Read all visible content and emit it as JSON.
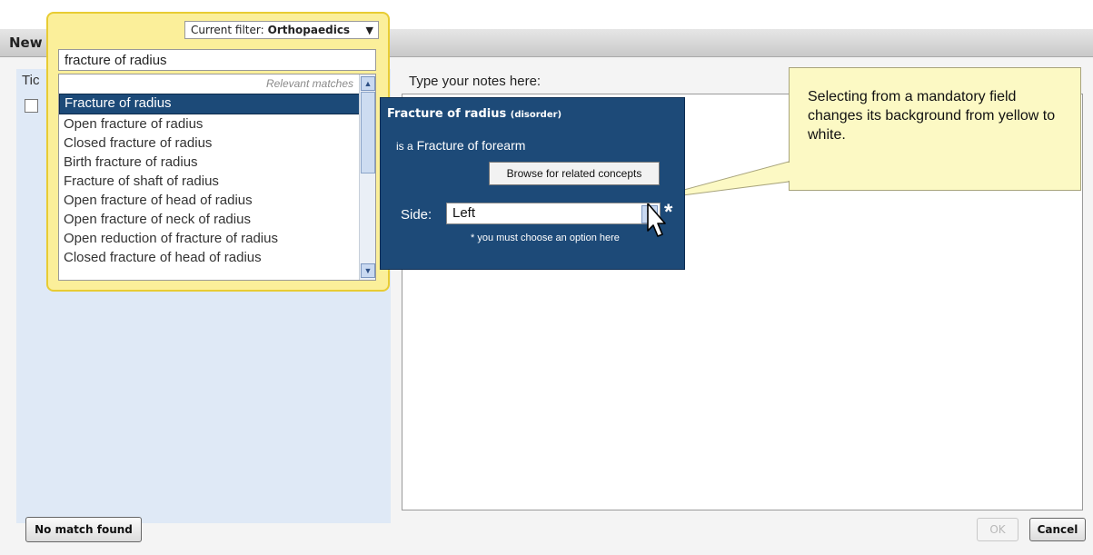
{
  "window": {
    "title": "New"
  },
  "left_panel": {
    "label": "Tic"
  },
  "autocomplete": {
    "filter_label": "Current filter:",
    "filter_value": "Orthopaedics",
    "search_value": "fracture of radius",
    "list_header": "Relevant matches",
    "items": [
      "Fracture of radius",
      "Open fracture of radius",
      "Closed fracture of radius",
      "Birth fracture of radius",
      "Fracture of shaft of radius",
      "Open fracture of head of radius",
      "Open fracture of neck of radius",
      "Open reduction of fracture of radius",
      "Closed fracture of head of radius"
    ],
    "selected_index": 0
  },
  "detail": {
    "title": "Fracture of radius",
    "semantic_tag": "(disorder)",
    "is_a_prefix": "is a",
    "is_a_value": "Fracture of forearm",
    "browse_label": "Browse for related concepts",
    "side_label": "Side:",
    "side_value": "Left",
    "required_mark": "*",
    "required_note": "* you must choose an option here"
  },
  "notes": {
    "label": "Type your notes here:"
  },
  "callout": {
    "text": "Selecting from a mandatory field changes its background from yellow to white."
  },
  "buttons": {
    "no_match": "No match found",
    "ok": "OK",
    "cancel": "Cancel"
  },
  "colors": {
    "accent_blue": "#1d4a78",
    "highlight_yellow": "#fbef9a",
    "callout_fill": "#fcf9c4"
  }
}
